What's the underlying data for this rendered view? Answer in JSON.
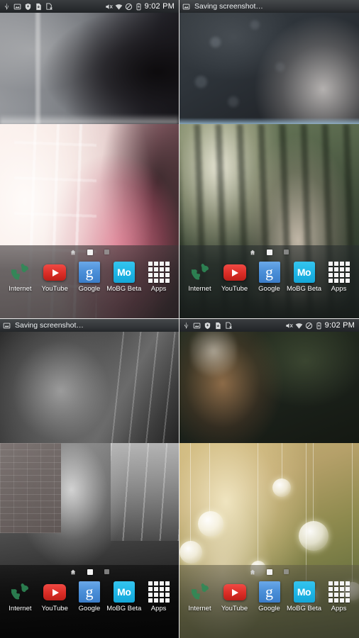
{
  "meta": {
    "kind": "android-home-screen-collage",
    "grid": "2x2",
    "panel_count": 4
  },
  "statusbar": {
    "clock": "9:02 PM",
    "toast_message": "Saving screenshot…",
    "left_icons": [
      "usb-icon",
      "screenshot-image-icon",
      "shield-download-icon",
      "file-download-icon",
      "file-delete-icon"
    ],
    "right_icons": [
      "mute-vibrate-icon",
      "wifi-icon",
      "do-not-disturb-icon",
      "battery-charging-icon"
    ]
  },
  "dock": {
    "page_indicators": [
      "home-page-icon",
      "page-square-active",
      "page-square-inactive"
    ],
    "items": [
      {
        "label": "Internet",
        "icon": "globe-icon"
      },
      {
        "label": "YouTube",
        "icon": "youtube-play-icon"
      },
      {
        "label": "Google",
        "icon": "google-g-icon",
        "glyph": "g"
      },
      {
        "label": "MoBG Beta",
        "icon": "mobg-icon",
        "glyph": "Mo"
      },
      {
        "label": "Apps",
        "icon": "apps-grid-icon"
      }
    ]
  },
  "panels": [
    {
      "id": "top-left",
      "statusbar_variant": "icons",
      "wallpapers": [
        {
          "slot": "top",
          "description": "dark window light, brunette woman silhouette"
        },
        {
          "slot": "bottom",
          "description": "bright window, woman in pink top holding mug"
        }
      ]
    },
    {
      "id": "top-right",
      "statusbar_variant": "toast",
      "wallpapers": [
        {
          "slot": "top",
          "description": "dark bokeh, pale blonde hair closeup"
        },
        {
          "slot": "bottom",
          "description": "sunlit forest, blonde woman in blue tank top"
        }
      ]
    },
    {
      "id": "bottom-left",
      "statusbar_variant": "toast",
      "wallpapers": [
        {
          "slot": "top",
          "description": "black and white face closeup"
        },
        {
          "slot": "bottom",
          "description": "black and white woman on phone by brick wall"
        }
      ]
    },
    {
      "id": "bottom-right",
      "statusbar_variant": "icons",
      "wallpapers": [
        {
          "slot": "top",
          "description": "dark moody portrait with flower crown"
        },
        {
          "slot": "bottom",
          "description": "golden hour portrait with hanging white lantern orbs"
        }
      ]
    }
  ],
  "colors": {
    "accent_mobg": "#1fb6e6",
    "accent_youtube": "#db2d26",
    "accent_google": "#4b8fd8",
    "statusbar_bg": "#2b2e31",
    "text_on_dark": "#ffffff"
  }
}
